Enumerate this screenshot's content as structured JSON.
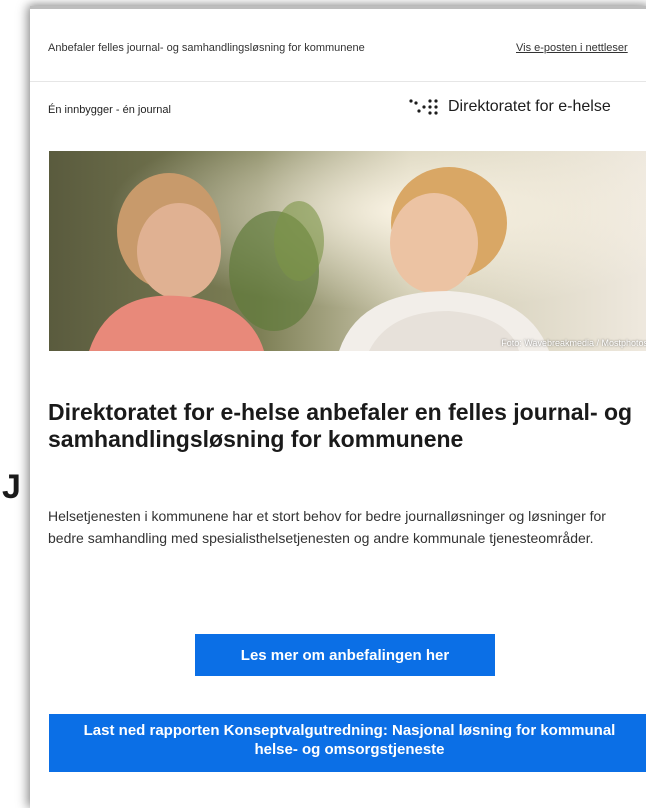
{
  "header": {
    "preheader_text": "Anbefaler felles journal- og samhandlingsløsning for kommunene",
    "view_in_browser_label": "Vis e-posten i nettleser"
  },
  "branding": {
    "tagline": "Én innbygger - én journal",
    "organization_name": "Direktoratet for e-helse",
    "logo_icon": "dots-logo-icon"
  },
  "hero": {
    "photo_credit": "Foto: Wavebreakmedia / Mostphotos"
  },
  "article": {
    "headline": "Direktoratet for e-helse anbefaler en felles journal- og samhandlingsløsning for kommunene",
    "intro": "Helsetjenesten i kommunene har et stort behov for bedre journalløsninger og løsninger for bedre samhandling med spesialisthelsetjenesten og andre kommunale tjenesteområder."
  },
  "buttons": {
    "read_more_label": "Les mer om anbefalingen her",
    "download_report_label": "Last ned rapporten Konseptvalgutredning: Nasjonal løsning for kommunal helse- og omsorgstjeneste"
  },
  "colors": {
    "accent_blue": "#0b6fe6",
    "heading_text": "#1a1a1a",
    "body_text": "#333333"
  },
  "misc": {
    "stray_glyph": "J"
  }
}
